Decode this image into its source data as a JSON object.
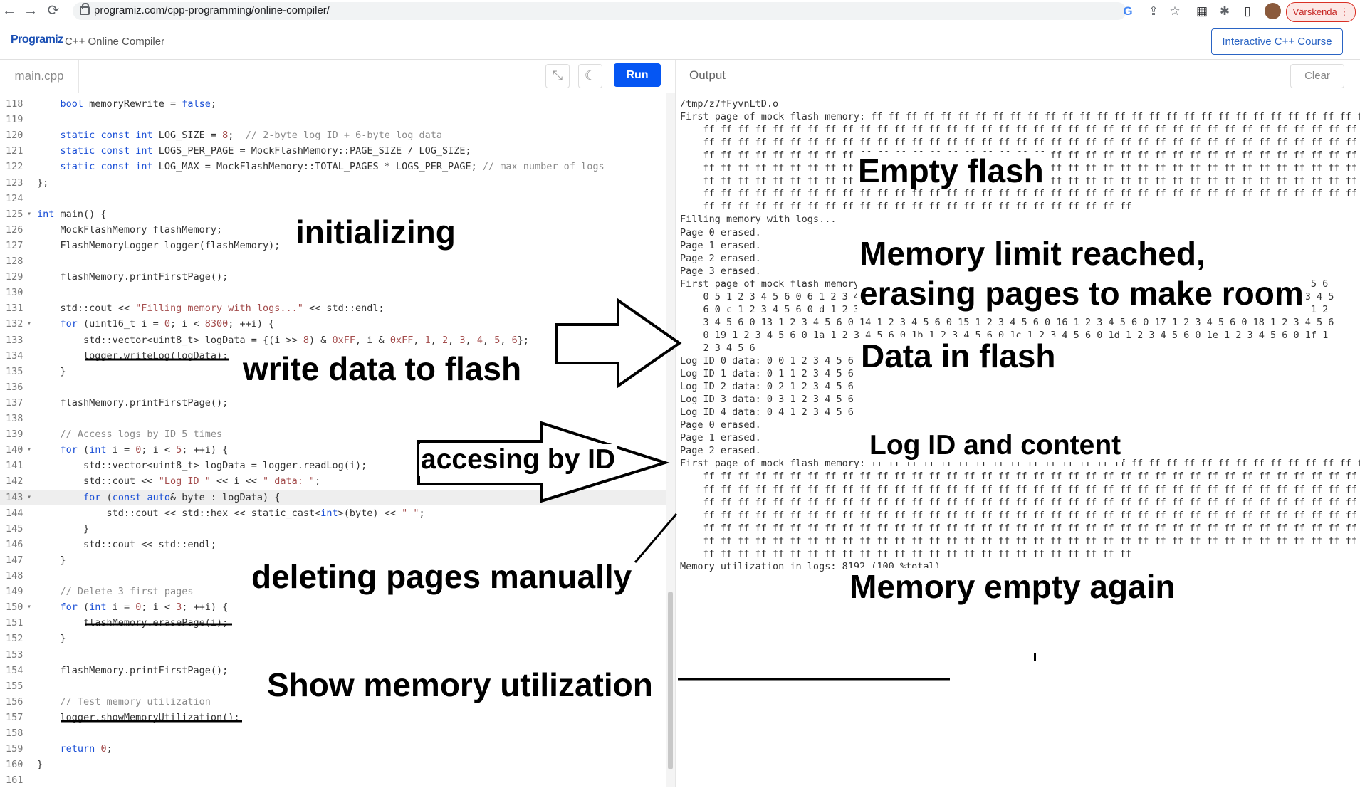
{
  "browser": {
    "url": "programiz.com/cpp-programming/online-compiler/",
    "profile_label": "Värskenda",
    "nav": {
      "back": "←",
      "forward": "→",
      "reload": "⟳"
    },
    "ext_icons": {
      "google": "G",
      "share": "⇪",
      "star": "☆",
      "grid": "▦",
      "puzzle": "✱",
      "panel": "▯",
      "menu": "⋮"
    }
  },
  "site": {
    "logo": "Programiz",
    "title": "C++ Online Compiler",
    "course_button": "Interactive C++ Course"
  },
  "editor": {
    "file_name": "main.cpp",
    "expand_icon": "⤡",
    "theme_icon": "☾",
    "run_label": "Run",
    "lines": [
      {
        "n": "118",
        "code": "    bool memoryRewrite = false;"
      },
      {
        "n": "119",
        "code": ""
      },
      {
        "n": "120",
        "code": "    static const int LOG_SIZE = 8;  // 2-byte log ID + 6-byte log data"
      },
      {
        "n": "121",
        "code": "    static const int LOGS_PER_PAGE = MockFlashMemory::PAGE_SIZE / LOG_SIZE;"
      },
      {
        "n": "122",
        "code": "    static const int LOG_MAX = MockFlashMemory::TOTAL_PAGES * LOGS_PER_PAGE; // max number of logs"
      },
      {
        "n": "123",
        "code": "};"
      },
      {
        "n": "124",
        "code": ""
      },
      {
        "n": "125",
        "code": "int main() {",
        "fold": true
      },
      {
        "n": "126",
        "code": "    MockFlashMemory flashMemory;"
      },
      {
        "n": "127",
        "code": "    FlashMemoryLogger logger(flashMemory);"
      },
      {
        "n": "128",
        "code": ""
      },
      {
        "n": "129",
        "code": "    flashMemory.printFirstPage();"
      },
      {
        "n": "130",
        "code": ""
      },
      {
        "n": "131",
        "code": "    std::cout << \"Filling memory with logs...\" << std::endl;"
      },
      {
        "n": "132",
        "code": "    for (uint16_t i = 0; i < 8300; ++i) {",
        "fold": true
      },
      {
        "n": "133",
        "code": "        std::vector<uint8_t> logData = {(i >> 8) & 0xFF, i & 0xFF, 1, 2, 3, 4, 5, 6};"
      },
      {
        "n": "134",
        "code": "        logger.writeLog(logData);"
      },
      {
        "n": "135",
        "code": "    }"
      },
      {
        "n": "136",
        "code": ""
      },
      {
        "n": "137",
        "code": "    flashMemory.printFirstPage();"
      },
      {
        "n": "138",
        "code": ""
      },
      {
        "n": "139",
        "code": "    // Access logs by ID 5 times"
      },
      {
        "n": "140",
        "code": "    for (int i = 0; i < 5; ++i) {",
        "fold": true
      },
      {
        "n": "141",
        "code": "        std::vector<uint8_t> logData = logger.readLog(i);"
      },
      {
        "n": "142",
        "code": "        std::cout << \"Log ID \" << i << \" data: \";"
      },
      {
        "n": "143",
        "code": "        for (const auto& byte : logData) {",
        "fold": true,
        "active": true
      },
      {
        "n": "144",
        "code": "            std::cout << std::hex << static_cast<int>(byte) << \" \";"
      },
      {
        "n": "145",
        "code": "        }"
      },
      {
        "n": "146",
        "code": "        std::cout << std::endl;"
      },
      {
        "n": "147",
        "code": "    }"
      },
      {
        "n": "148",
        "code": ""
      },
      {
        "n": "149",
        "code": "    // Delete 3 first pages"
      },
      {
        "n": "150",
        "code": "    for (int i = 0; i < 3; ++i) {",
        "fold": true
      },
      {
        "n": "151",
        "code": "        flashMemory.erasePage(i);"
      },
      {
        "n": "152",
        "code": "    }"
      },
      {
        "n": "153",
        "code": ""
      },
      {
        "n": "154",
        "code": "    flashMemory.printFirstPage();"
      },
      {
        "n": "155",
        "code": ""
      },
      {
        "n": "156",
        "code": "    // Test memory utilization"
      },
      {
        "n": "157",
        "code": "    logger.showMemoryUtilization();"
      },
      {
        "n": "158",
        "code": ""
      },
      {
        "n": "159",
        "code": "    return 0;"
      },
      {
        "n": "160",
        "code": "}"
      },
      {
        "n": "161",
        "code": ""
      }
    ]
  },
  "output": {
    "title": "Output",
    "clear_label": "Clear",
    "lines": [
      "/tmp/z7fFyvnLtD.o",
      "First page of mock flash memory: ff ff ff ff ff ff ff ff ff ff ff ff ff ff ff ff ff ff ff ff ff ff ff ff ff ff ff ff ff ff ff ff ff ff ff ff ff ff ff ff",
      "    ff ff ff ff ff ff ff ff ff ff ff ff ff ff ff ff ff ff ff ff ff ff ff ff ff ff ff ff ff ff ff ff ff ff ff ff ff ff ff ff",
      "    ff ff ff ff ff ff ff ff ff ff ff ff ff ff ff ff ff ff ff ff ff ff ff ff ff ff ff ff ff ff ff ff ff ff ff ff ff ff ff ff",
      "    ff ff ff ff ff ff ff ff ff ff ff ff ff ff ff ff ff ff ff ff ff ff ff ff ff ff ff ff ff ff ff ff ff ff ff ff ff ff ff ff",
      "    ff ff ff ff ff ff ff ff ff ff ff ff ff ff ff ff ff ff ff ff ff ff ff ff ff ff ff ff ff ff ff ff ff ff ff ff ff ff ff ff",
      "    ff ff ff ff ff ff ff ff ff ff ff ff ff ff ff ff ff ff ff ff ff ff ff ff ff ff ff ff ff ff ff ff ff ff ff ff ff ff ff ff",
      "    ff ff ff ff ff ff ff ff ff ff ff ff ff ff ff ff ff ff ff ff ff ff ff ff ff ff ff ff ff ff ff ff ff ff ff ff ff ff ff ff",
      "    ff ff ff ff ff ff ff ff ff ff ff ff ff ff ff ff ff ff ff ff ff ff ff ff ff",
      "Filling memory with logs...",
      "Page 0 erased.",
      "Page 1 erased.",
      "Page 2 erased.",
      "Page 3 erased.",
      "First page of mock flash memory: 0 0 1 2 3 4 5 6 0 1 1 2 3 4 5 6 0 2 1 2 3 4 5 6 0 3 1 2 3 4 5 6 0 4 1 2 3 4 5 6",
      "    0 5 1 2 3 4 5 6 0 6 1 2 3 4 5 6 0 7 1 2 3 4 5 6 0 8 1 2 3 4 5 6 0 9 1 2 3 4 5 6 0 a 1 2 3 4 5 6 0 b 1 2 3 4 5",
      "    6 0 c 1 2 3 4 5 6 0 d 1 2 3 4 5 6 0 e 1 2 3 4 5 6 0 f 1 2 3 4 5 6 0 10 1 2 3 4 5 6 0 11 1 2 3 4 5 6 0 12 1 2",
      "    3 4 5 6 0 13 1 2 3 4 5 6 0 14 1 2 3 4 5 6 0 15 1 2 3 4 5 6 0 16 1 2 3 4 5 6 0 17 1 2 3 4 5 6 0 18 1 2 3 4 5 6",
      "    0 19 1 2 3 4 5 6 0 1a 1 2 3 4 5 6 0 1b 1 2 3 4 5 6 0 1c 1 2 3 4 5 6 0 1d 1 2 3 4 5 6 0 1e 1 2 3 4 5 6 0 1f 1",
      "    2 3 4 5 6",
      "Log ID 0 data: 0 0 1 2 3 4 5 6",
      "Log ID 1 data: 0 1 1 2 3 4 5 6",
      "Log ID 2 data: 0 2 1 2 3 4 5 6",
      "Log ID 3 data: 0 3 1 2 3 4 5 6",
      "Log ID 4 data: 0 4 1 2 3 4 5 6",
      "Page 0 erased.",
      "Page 1 erased.",
      "Page 2 erased.",
      "First page of mock flash memory: ff ff ff ff ff ff ff ff ff ff ff ff ff ff ff ff ff ff ff ff ff ff ff ff ff ff ff ff ff ff ff ff ff ff ff ff ff ff ff ff",
      "    ff ff ff ff ff ff ff ff ff ff ff ff ff ff ff ff ff ff ff ff ff ff ff ff ff ff ff ff ff ff ff ff ff ff ff ff ff ff ff ff",
      "    ff ff ff ff ff ff ff ff ff ff ff ff ff ff ff ff ff ff ff ff ff ff ff ff ff ff ff ff ff ff ff ff ff ff ff ff ff ff ff ff",
      "    ff ff ff ff ff ff ff ff ff ff ff ff ff ff ff ff ff ff ff ff ff ff ff ff ff ff ff ff ff ff ff ff ff ff ff ff ff ff ff ff",
      "    ff ff ff ff ff ff ff ff ff ff ff ff ff ff ff ff ff ff ff ff ff ff ff ff ff ff ff ff ff ff ff ff ff ff ff ff ff ff ff ff",
      "    ff ff ff ff ff ff ff ff ff ff ff ff ff ff ff ff ff ff ff ff ff ff ff ff ff ff ff ff ff ff ff ff ff ff ff ff ff ff ff ff",
      "    ff ff ff ff ff ff ff ff ff ff ff ff ff ff ff ff ff ff ff ff ff ff ff ff ff ff ff ff ff ff ff ff ff ff ff ff ff ff ff ff",
      "    ff ff ff ff ff ff ff ff ff ff ff ff ff ff ff ff ff ff ff ff ff ff ff ff ff",
      "Memory utilization in logs: 8192 (100 %total)"
    ]
  },
  "annotations": {
    "initializing": "initializing",
    "write_data": "write data to flash",
    "accessing": "accesing by ID",
    "deleting": "deleting pages manually",
    "show_mem": "Show memory utilization",
    "empty_flash": "Empty flash",
    "mem_limit_1": "Memory limit reached,",
    "mem_limit_2": "erasing pages to make room",
    "data_in_flash": "Data in flash",
    "log_id": "Log ID and content",
    "mem_empty": "Memory empty again"
  }
}
